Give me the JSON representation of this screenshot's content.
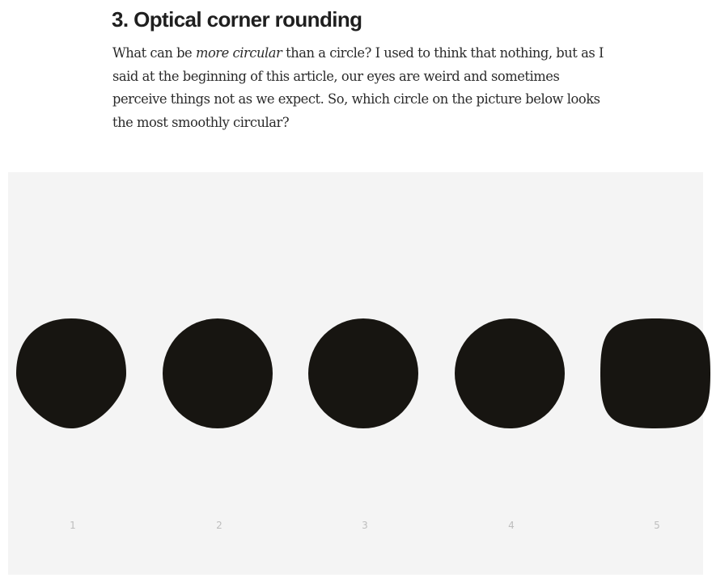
{
  "article": {
    "heading": "3. Optical corner rounding",
    "paragraph": {
      "before_em": "What can be ",
      "em": "more circular",
      "after_em": " than a circle? I used to think that nothing, but as I said at the beginning of this article, our eyes are weird and sometimes perceive things not as we expect. So, which circle on the picture below looks the most smoothly circular?"
    }
  },
  "figure": {
    "background": "#f4f4f4",
    "shape_color": "#171511",
    "shapes": [
      {
        "label": "1",
        "variant": "pinched-circle"
      },
      {
        "label": "2",
        "variant": "circle"
      },
      {
        "label": "3",
        "variant": "circle"
      },
      {
        "label": "4",
        "variant": "circle"
      },
      {
        "label": "5",
        "variant": "squircle"
      }
    ]
  }
}
